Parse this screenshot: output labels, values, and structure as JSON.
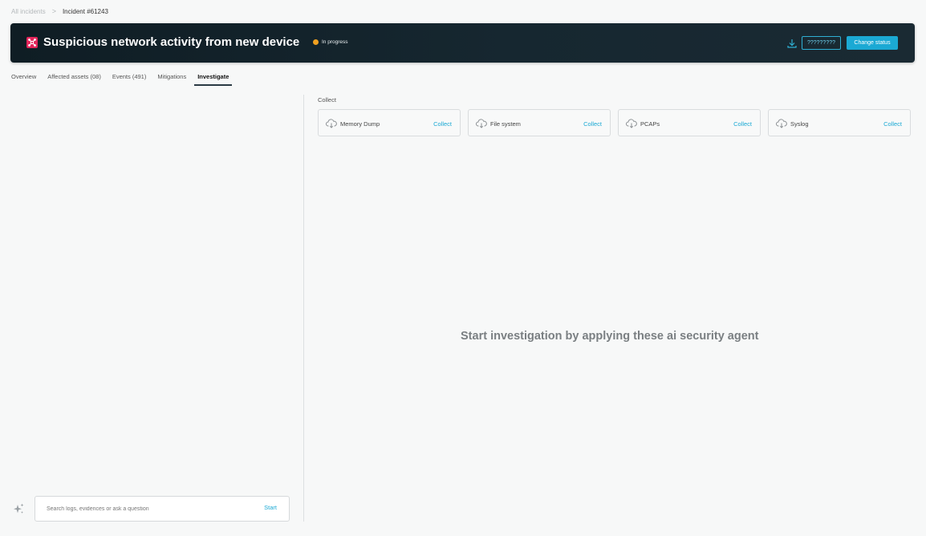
{
  "breadcrumb": {
    "parent": "All incidents",
    "separator": ">",
    "current": "Incident #61243"
  },
  "incident": {
    "title": "Suspicious network activity from new device",
    "status": "In progress",
    "status_color": "#f0a020",
    "alert_color": "#e2255a",
    "icon": "alert-network-icon"
  },
  "actions": {
    "download_icon": "download-icon",
    "unknown_label": "?????????",
    "change_status_label": "Change status"
  },
  "tabs": [
    {
      "label": "Overview",
      "active": false
    },
    {
      "label": "Affected assets (08)",
      "active": false
    },
    {
      "label": "Events (491)",
      "active": false
    },
    {
      "label": "Mitigations",
      "active": false
    },
    {
      "label": "Investigate",
      "active": true
    }
  ],
  "collect": {
    "label": "Collect",
    "items": [
      {
        "label": "Memory Dump",
        "action": "Collect",
        "icon": "cloud-download-icon"
      },
      {
        "label": "File system",
        "action": "Collect",
        "icon": "cloud-download-icon"
      },
      {
        "label": "PCAPs",
        "action": "Collect",
        "icon": "cloud-download-icon"
      },
      {
        "label": "Syslog",
        "action": "Collect",
        "icon": "cloud-download-icon"
      }
    ]
  },
  "empty_state": {
    "message": "Start investigation by applying these ai security agent"
  },
  "search": {
    "placeholder": "Search logs, evidences or ask a question",
    "value": "",
    "start_label": "Start",
    "icon": "sparkle-icon"
  },
  "colors": {
    "accent": "#1ba9d4",
    "banner_bg": "#13222a"
  }
}
